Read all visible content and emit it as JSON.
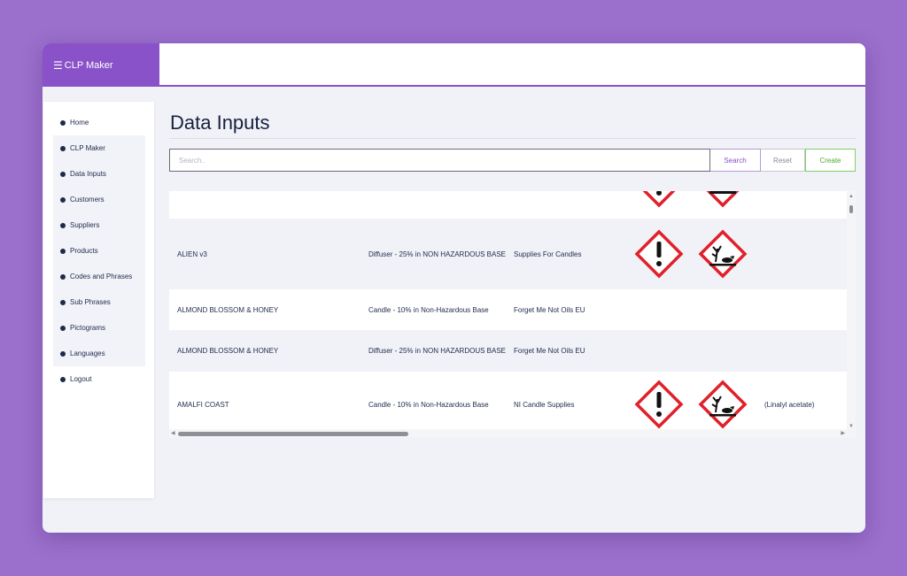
{
  "brand": {
    "menu_icon": "hamburger-icon",
    "title": "CLP Maker",
    "color": "#8a52c8"
  },
  "sidebar": {
    "items": [
      {
        "label": "Home"
      },
      {
        "label": "CLP Maker"
      },
      {
        "label": "Data Inputs"
      },
      {
        "label": "Customers"
      },
      {
        "label": "Suppliers"
      },
      {
        "label": "Products"
      },
      {
        "label": "Codes and Phrases"
      },
      {
        "label": "Sub Phrases"
      },
      {
        "label": "Pictograms"
      },
      {
        "label": "Languages"
      },
      {
        "label": "Logout"
      }
    ]
  },
  "main": {
    "title": "Data Inputs",
    "search": {
      "placeholder": "Search..",
      "value": ""
    },
    "buttons": {
      "search": "Search",
      "reset": "Reset",
      "create": "Create"
    }
  },
  "table": {
    "rows": [
      {
        "name": "",
        "base": "",
        "supplier": "",
        "pictograms": [
          "exclamation-mark-icon",
          "environment-hazard-icon"
        ],
        "note": ""
      },
      {
        "name": "ALIEN v3",
        "base": "Diffuser - 25% in NON HAZARDOUS BASE",
        "supplier": "Supplies For Candles",
        "pictograms": [
          "exclamation-mark-icon",
          "environment-hazard-icon"
        ],
        "note": ""
      },
      {
        "name": "ALMOND BLOSSOM & HONEY",
        "base": "Candle - 10% in Non-Hazardous Base",
        "supplier": "Forget Me Not Oils EU",
        "pictograms": [],
        "note": ""
      },
      {
        "name": "ALMOND BLOSSOM & HONEY",
        "base": "Diffuser - 25% in NON HAZARDOUS BASE",
        "supplier": "Forget Me Not Oils EU",
        "pictograms": [],
        "note": ""
      },
      {
        "name": "AMALFI COAST",
        "base": "Candle - 10% in Non-Hazardous Base",
        "supplier": "NI Candle Supplies",
        "pictograms": [
          "exclamation-mark-icon",
          "environment-hazard-icon"
        ],
        "note": "(Linalyl acetate)"
      }
    ]
  },
  "colors": {
    "background": "#9b6fcc",
    "accent": "#8a52c8",
    "create": "#4caf28",
    "hazard_red": "#e0202a"
  }
}
